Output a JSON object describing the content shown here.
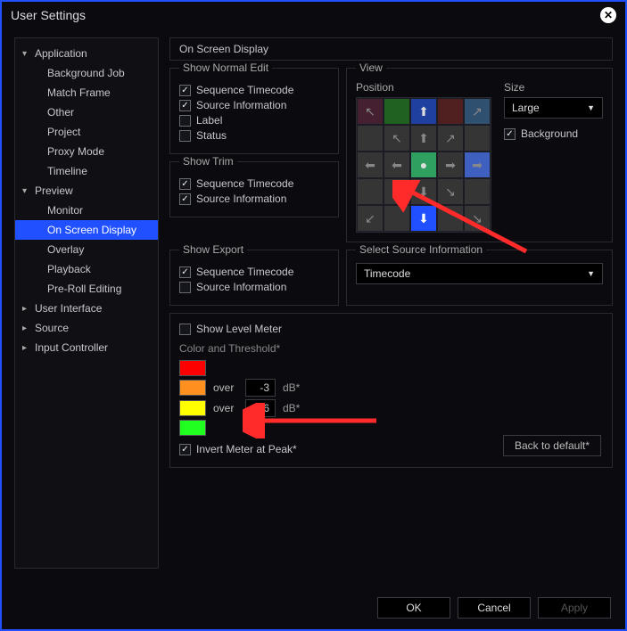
{
  "window": {
    "title": "User Settings"
  },
  "sidebar": {
    "items": [
      {
        "label": "Application",
        "expandable": true,
        "expanded": true
      },
      {
        "label": "Background Job"
      },
      {
        "label": "Match Frame"
      },
      {
        "label": "Other"
      },
      {
        "label": "Project"
      },
      {
        "label": "Proxy Mode"
      },
      {
        "label": "Timeline"
      },
      {
        "label": "Preview",
        "expandable": true,
        "expanded": true
      },
      {
        "label": "Monitor"
      },
      {
        "label": "On Screen Display",
        "selected": true
      },
      {
        "label": "Overlay"
      },
      {
        "label": "Playback"
      },
      {
        "label": "Pre-Roll Editing"
      },
      {
        "label": "User Interface",
        "expandable": true,
        "expanded": false
      },
      {
        "label": "Source",
        "expandable": true,
        "expanded": false
      },
      {
        "label": "Input Controller",
        "expandable": true,
        "expanded": false
      }
    ]
  },
  "main": {
    "header": "On Screen Display",
    "show_normal_edit": {
      "title": "Show Normal Edit",
      "items": [
        {
          "label": "Sequence Timecode",
          "checked": true
        },
        {
          "label": "Source Information",
          "checked": true
        },
        {
          "label": "Label",
          "checked": false
        },
        {
          "label": "Status",
          "checked": false
        }
      ]
    },
    "show_trim": {
      "title": "Show Trim",
      "items": [
        {
          "label": "Sequence Timecode",
          "checked": true
        },
        {
          "label": "Source Information",
          "checked": true
        }
      ]
    },
    "show_export": {
      "title": "Show Export",
      "items": [
        {
          "label": "Sequence Timecode",
          "checked": true
        },
        {
          "label": "Source Information",
          "checked": false
        }
      ]
    },
    "view": {
      "title": "View",
      "position_label": "Position",
      "size_label": "Size",
      "size_value": "Large",
      "background": {
        "label": "Background",
        "checked": true
      }
    },
    "select_source": {
      "title": "Select Source Information",
      "value": "Timecode"
    },
    "level_meter": {
      "show_label": "Show Level Meter",
      "show_checked": false,
      "color_threshold_label": "Color and Threshold*",
      "over_word": "over",
      "db_label": "dB*",
      "rows": [
        {
          "color": "#ff0000"
        },
        {
          "color": "#ff9020",
          "value": "-3"
        },
        {
          "color": "#ffff00",
          "value": "-6"
        },
        {
          "color": "#20ff20"
        }
      ],
      "invert": {
        "label": "Invert Meter at Peak*",
        "checked": true
      },
      "back_default": "Back to default*"
    }
  },
  "footer": {
    "ok": "OK",
    "cancel": "Cancel",
    "apply": "Apply"
  }
}
